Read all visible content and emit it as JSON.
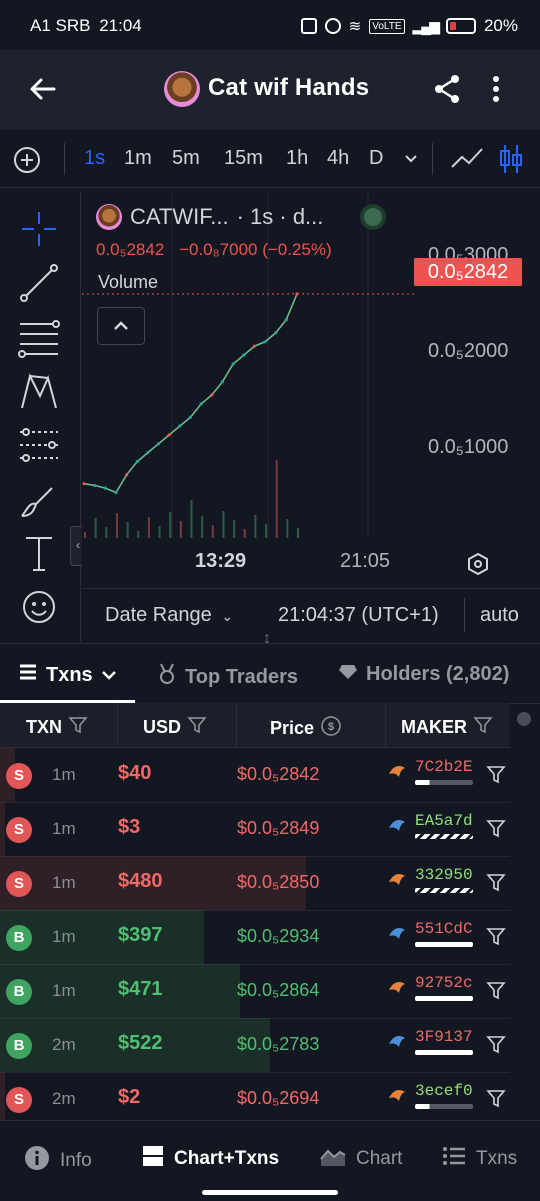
{
  "status_bar": {
    "carrier": "A1 SRB",
    "time": "21:04",
    "battery": "20%",
    "network": "VoLTE"
  },
  "header": {
    "back_icon": "arrow-left-icon",
    "title": "Cat wif Hands",
    "share_icon": "share-icon",
    "more_icon": "more-vertical-icon"
  },
  "timeframes": {
    "items": [
      "1s",
      "1m",
      "5m",
      "15m",
      "1h",
      "4h",
      "D"
    ],
    "active": "1s",
    "dropdown_icon": "chevron-down-icon",
    "chart_types": [
      "line-chart-icon",
      "candlestick-icon"
    ]
  },
  "left_tools": [
    "crosshair-icon",
    "trendline-icon",
    "fib-icon",
    "pattern-icon",
    "prediction-icon",
    "brush-icon",
    "text-icon",
    "emoji-icon"
  ],
  "chart": {
    "symbol": "CATWIF...",
    "interval": "· 1s · d...",
    "ohlc_price": "0.0₅2842",
    "ohlc_change": "−0.0₈7000 (−0.25%)",
    "volume_label": "Volume",
    "price_ticks": [
      {
        "label": "0.0₅3000",
        "value": 3e-06
      },
      {
        "label": "0.0₅2000",
        "value": 2e-06
      },
      {
        "label": "0.0₅1000",
        "value": 1e-06
      }
    ],
    "last_price_tag": "0.0₅2842",
    "time_ticks": [
      "13:29",
      "21:05"
    ],
    "date_range": "Date Range",
    "clock": "21:04:37 (UTC+1)",
    "auto": "auto"
  },
  "chart_data": {
    "type": "line",
    "title": "CATWIF...",
    "xlabel": "",
    "ylabel": "",
    "x": [
      0,
      1,
      2,
      3,
      4,
      5,
      6,
      7,
      8,
      9,
      10,
      11,
      12,
      13,
      14,
      15,
      16,
      17,
      18,
      19,
      20
    ],
    "series": [
      {
        "values": [
          7e-07,
          6.8e-07,
          6.5e-07,
          6e-07,
          8e-07,
          9.5e-07,
          1.05e-06,
          1.15e-06,
          1.25e-06,
          1.35e-06,
          1.45e-06,
          1.6e-06,
          1.7e-06,
          1.85e-06,
          2.05e-06,
          2.15e-06,
          2.25e-06,
          2.3e-06,
          2.4e-06,
          2.55e-06,
          2.84e-06
        ]
      }
    ],
    "ylim": [
      2e-07,
      3.2e-06
    ]
  },
  "tabs": [
    {
      "label": "Txns",
      "icon": "list-icon",
      "active": true
    },
    {
      "label": "Top Traders",
      "icon": "medal-icon",
      "active": false
    },
    {
      "label": "Holders (2,802)",
      "icon": "diamond-icon",
      "active": false
    }
  ],
  "table": {
    "headers": [
      "TXN",
      "USD",
      "Price",
      "MAKER"
    ],
    "rows": [
      {
        "type": "S",
        "age": "1m",
        "usd": "$40",
        "price": "$0.0₅2842",
        "maker": "7C2b2E",
        "color": "#ef6a66",
        "bar": "partial",
        "bg_fill": 0.03
      },
      {
        "type": "S",
        "age": "1m",
        "usd": "$3",
        "price": "$0.0₅2849",
        "maker": "EA5a7d",
        "color": "#8fe07a",
        "bar": "striped",
        "bg_fill": 0.01
      },
      {
        "type": "S",
        "age": "1m",
        "usd": "$480",
        "price": "$0.0₅2850",
        "maker": "332950",
        "color": "#8fe07a",
        "bar": "striped",
        "bg_fill": 0.6
      },
      {
        "type": "B",
        "age": "1m",
        "usd": "$397",
        "price": "$0.0₅2934",
        "maker": "551CdC",
        "color": "#ef6a66",
        "bar": "full",
        "bg_fill": 0.4
      },
      {
        "type": "B",
        "age": "1m",
        "usd": "$471",
        "price": "$0.0₅2864",
        "maker": "92752c",
        "color": "#ef6a66",
        "bar": "full",
        "bg_fill": 0.47
      },
      {
        "type": "B",
        "age": "2m",
        "usd": "$522",
        "price": "$0.0₅2783",
        "maker": "3F9137",
        "color": "#ef6a66",
        "bar": "full",
        "bg_fill": 0.53
      },
      {
        "type": "S",
        "age": "2m",
        "usd": "$2",
        "price": "$0.0₅2694",
        "maker": "3ecef0",
        "color": "#8fe07a",
        "bar": "partial",
        "bg_fill": 0.01
      }
    ]
  },
  "bottom_nav": [
    {
      "label": "Info",
      "icon": "info-icon",
      "active": false
    },
    {
      "label": "Chart+Txns",
      "icon": "split-view-icon",
      "active": true
    },
    {
      "label": "Chart",
      "icon": "area-chart-icon",
      "active": false
    },
    {
      "label": "Txns",
      "icon": "list-icon",
      "active": false
    }
  ],
  "colors": {
    "background": "#131722",
    "sell": "#ef6a66",
    "buy": "#4fbf72",
    "accent": "#2962ff",
    "price_tag": "#ef5350"
  }
}
